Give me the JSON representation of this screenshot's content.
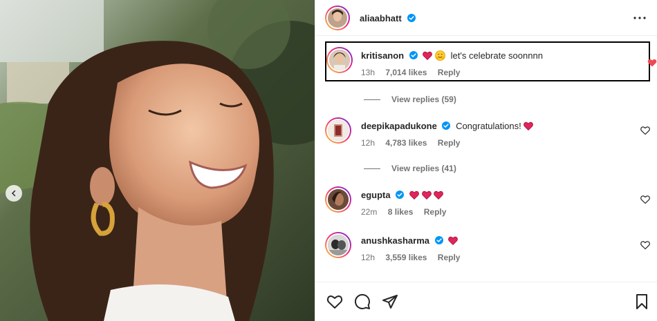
{
  "post": {
    "author": "aliaabhatt",
    "more_label": "More options"
  },
  "comments": [
    {
      "username": "kritisanon",
      "text": "let's celebrate soonnnn",
      "time": "13h",
      "likes": "7,014 likes",
      "reply": "Reply",
      "view_replies": "View replies (59)"
    },
    {
      "username": "deepikapadukone",
      "text": "Congratulations!",
      "time": "12h",
      "likes": "4,783 likes",
      "reply": "Reply",
      "view_replies": "View replies (41)"
    },
    {
      "username": "egupta",
      "text": "",
      "time": "22m",
      "likes": "8 likes",
      "reply": "Reply"
    },
    {
      "username": "anushkasharma",
      "text": "",
      "time": "12h",
      "likes": "3,559 likes",
      "reply": "Reply"
    }
  ],
  "colors": {
    "verified": "#0095f6",
    "heart_red": "#ed4956",
    "meta_gray": "#737373"
  },
  "icons": [
    "chevron-left-icon",
    "verified-badge-icon",
    "more-dots-icon",
    "heart-icon",
    "comment-icon",
    "share-icon",
    "bookmark-icon"
  ]
}
